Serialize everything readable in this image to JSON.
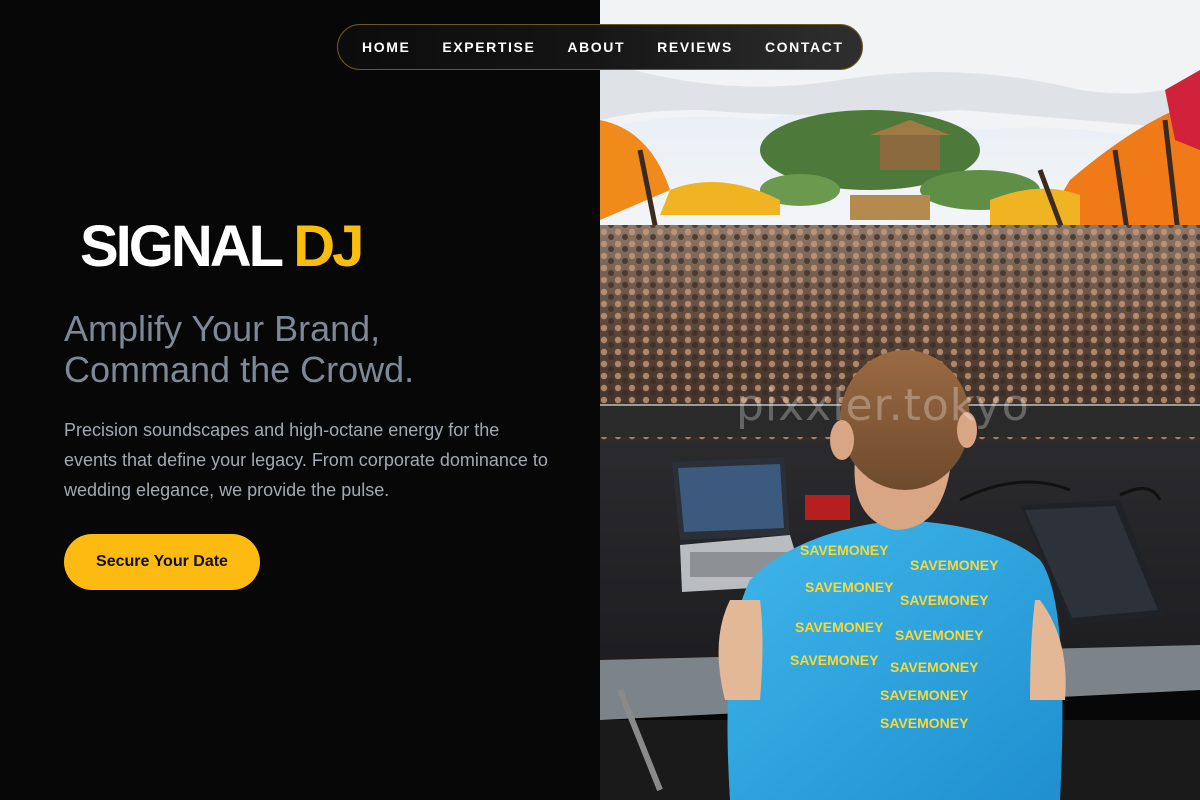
{
  "nav": {
    "items": [
      {
        "label": "HOME"
      },
      {
        "label": "EXPERTISE"
      },
      {
        "label": "ABOUT"
      },
      {
        "label": "REVIEWS"
      },
      {
        "label": "CONTACT"
      }
    ]
  },
  "hero": {
    "brand_main": "SIGNAL",
    "brand_accent": "DJ",
    "headline_line1": "Amplify Your Brand,",
    "headline_line2": "Command the Crowd.",
    "description": "Precision soundscapes and high-octane energy for the events that define your legacy. From corporate dominance to wedding elegance, we provide the pulse.",
    "cta_label": "Secure Your Date"
  },
  "photo": {
    "watermark": "pixxler.tokyo",
    "shirt_text": "SAVEMONEY"
  },
  "colors": {
    "accent": "#f9bd0d",
    "background": "#070707",
    "headline": "#7e8896",
    "body_text": "#a3a9b2"
  }
}
